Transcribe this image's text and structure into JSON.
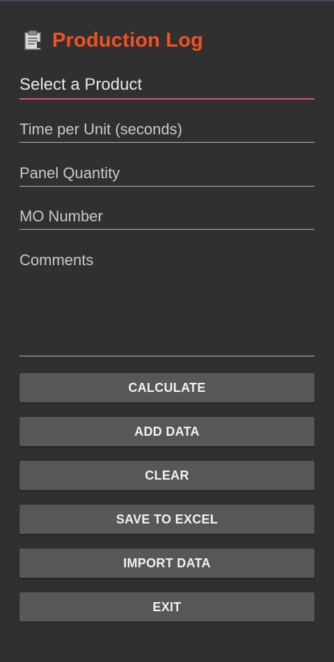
{
  "app": {
    "title": "Production Log",
    "icon": "clipboard-icon",
    "title_color": "#f4511e"
  },
  "form": {
    "product_select": {
      "placeholder": "Select a Product"
    },
    "time_per_unit": {
      "placeholder": "Time per Unit (seconds)"
    },
    "panel_quantity": {
      "placeholder": "Panel Quantity"
    },
    "mo_number": {
      "placeholder": "MO Number"
    },
    "comments": {
      "placeholder": "Comments"
    },
    "focus_color": "#e74c7c"
  },
  "buttons": {
    "calculate": "CALCULATE",
    "add_data": "ADD DATA",
    "clear": "CLEAR",
    "save_to_excel": "SAVE TO EXCEL",
    "import_data": "IMPORT DATA",
    "exit": "EXIT"
  }
}
